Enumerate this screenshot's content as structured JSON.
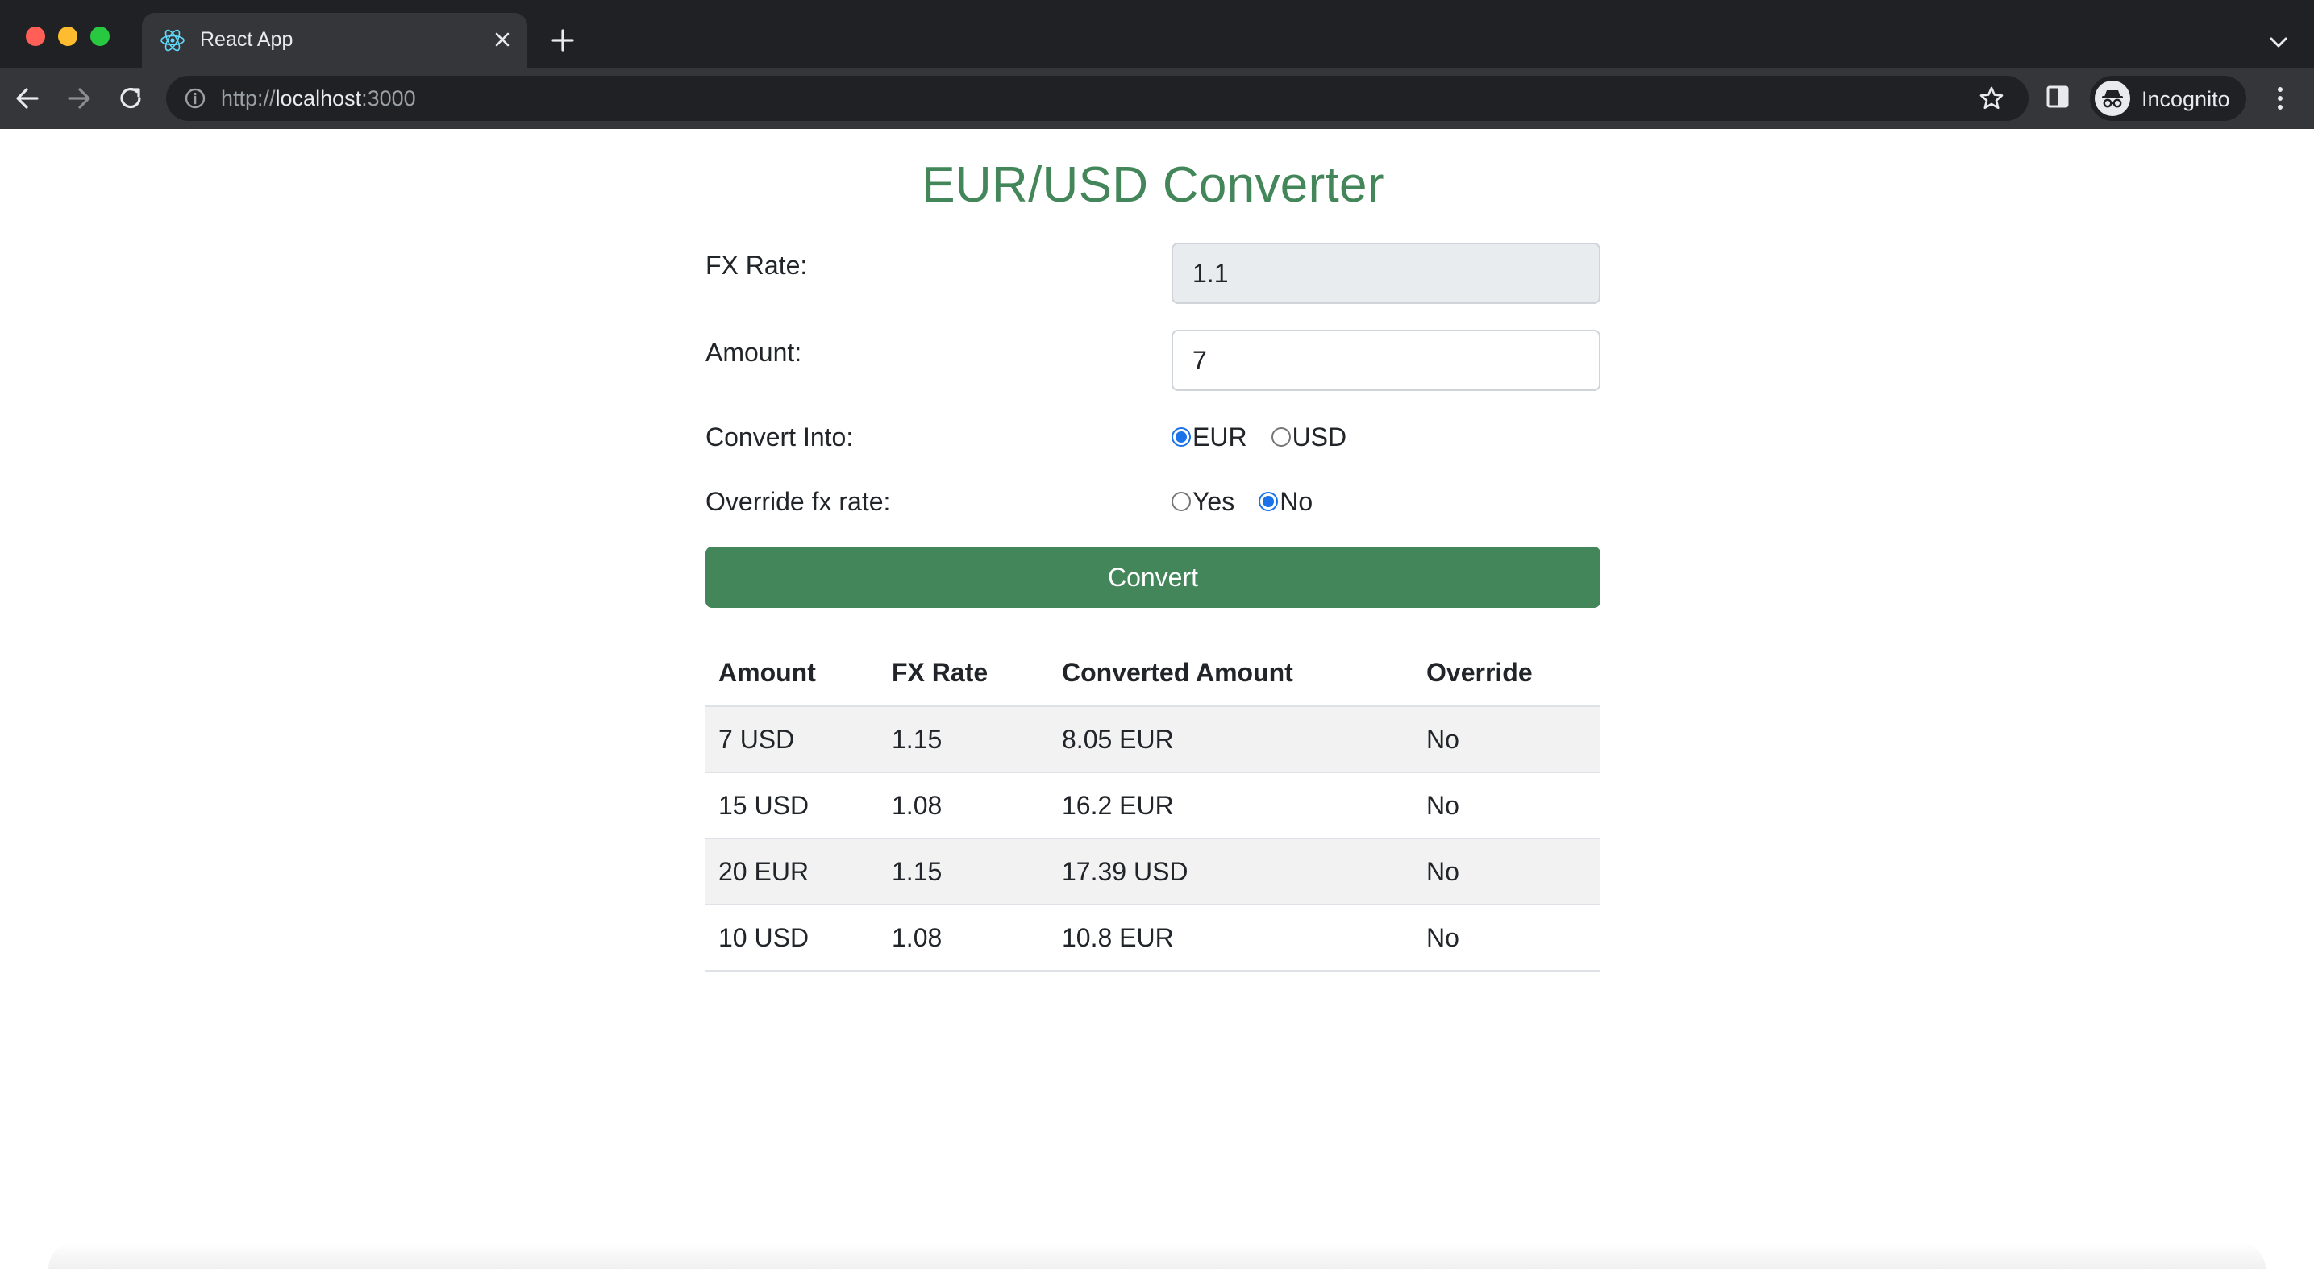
{
  "browser": {
    "tab_title": "React App",
    "url_scheme": "http://",
    "url_host": "localhost",
    "url_port": ":3000",
    "profile_label": "Incognito"
  },
  "app": {
    "title": "EUR/USD Converter",
    "accent_color": "#43865a",
    "form": {
      "fx_rate_label": "FX Rate:",
      "fx_rate_value": "1.1",
      "amount_label": "Amount:",
      "amount_value": "7",
      "convert_into_label": "Convert Into:",
      "convert_into_options": [
        "EUR",
        "USD"
      ],
      "convert_into_selected": "EUR",
      "override_label": "Override fx rate:",
      "override_options": [
        "Yes",
        "No"
      ],
      "override_selected": "No",
      "convert_button": "Convert"
    },
    "history": {
      "headers": [
        "Amount",
        "FX Rate",
        "Converted Amount",
        "Override"
      ],
      "rows": [
        [
          "7 USD",
          "1.15",
          "8.05 EUR",
          "No"
        ],
        [
          "15 USD",
          "1.08",
          "16.2 EUR",
          "No"
        ],
        [
          "20 EUR",
          "1.15",
          "17.39 USD",
          "No"
        ],
        [
          "10 USD",
          "1.08",
          "10.8 EUR",
          "No"
        ]
      ]
    }
  }
}
